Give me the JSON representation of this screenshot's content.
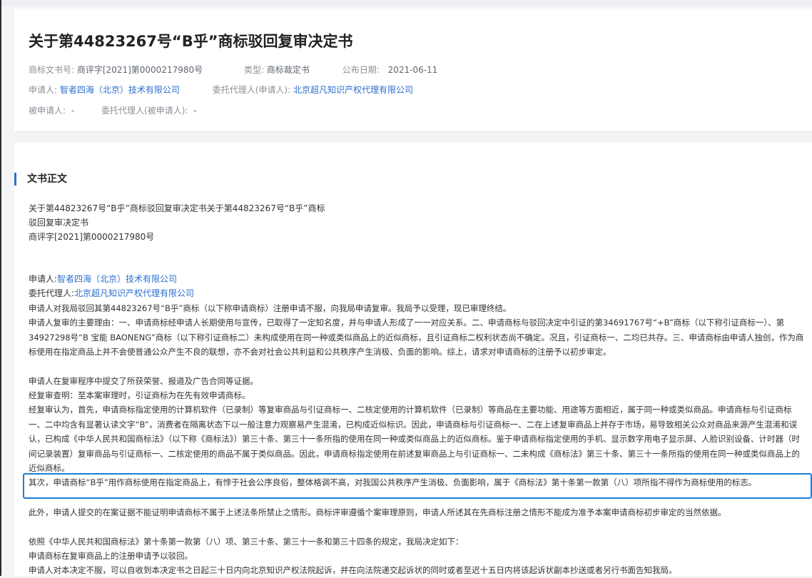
{
  "header": {
    "title": "关于第44823267号“B乎”商标驳回复审决定书",
    "doc_no_label": "商标文书号:",
    "doc_no": "商评字[2021]第0000217980号",
    "type_label": "类型:",
    "type": "商标裁定书",
    "date_label": "公布日期:",
    "date": "2021-06-11",
    "applicant_label": "申请人:",
    "applicant": "智者四海（北京）技术有限公司",
    "agent_label": "委托代理人(申请人):",
    "agent": "北京超凡知识产权代理有限公司",
    "respondent_label": "被申请人:",
    "respondent": "-",
    "resp_agent_label": "委托代理人(被申请人):",
    "resp_agent": "-"
  },
  "body": {
    "section_title": "文书正文",
    "intro": [
      "关于第44823267号“B乎”商标驳回复审决定书关于第44823267号“B乎”商标",
      "驳回复审决定书",
      "商评字[2021]第0000217980号"
    ],
    "applicant_label": "申请人:",
    "applicant": "智者四海（北京）技术有限公司",
    "agent_label": "委托代理人:",
    "agent": "北京超凡知识产权代理有限公司",
    "paragraphs": [
      "申请人对我局驳回其第44823267号“B乎”商标（以下称申请商标）注册申请不服，向我局申请复审。我局予以受理，现已审理终结。",
      "申请人复审的主要理由：一、申请商标经申请人长期使用与宣传，已取得了一定知名度，并与申请人形成了一一对应关系。二、申请商标与驳回决定中引证的第34691767号“+B”商标（以下称引证商标一）、第34927298号“B 宝能 BAONENG”商标（以下称引证商标二）未构成使用在同一种或类似商品上的近似商标，且引证商标二权利状态尚不确定。况且，引证商标一、二均已共存。三、申请商标由申请人独创，作为商标使用在指定商品上并不会使普通公众产生不良的联想，亦不会对社会公共利益和公共秩序产生消极、负面的影响。综上，请求对申请商标的注册予以初步审定。",
      "申请人在复审程序中提交了所获荣誉、报道及广告合同等证据。",
      "经复审查明：至本案审理时，引证商标为在先有效申请商标。",
      "经复审认为，首先，申请商标指定使用的计算机软件（已录制）等复审商品与引证商标一、二核定使用的计算机软件（已录制）等商品在主要功能、用途等方面相近，属于同一种或类似商品。申请商标与引证商标一、二中均含有显著认读文字“B”，消费者在隔离状态下以一般注意力观察易产生混淆，已构成近似标识。因此，申请商标与引证商标一、二在上述复审商品上并存于市场，易导致相关公众对商品来源产生混淆和误认，已构成《中华人民共和国商标法》（以下称《商标法》）第三十条、第三十一条所指的使用在同一种或类似商品上的近似商标。鉴于申请商标指定使用的手机、显示数字用电子显示屏、人脸识别设备、计时器（时间记录装置）复审商品与引证商标一、二核定使用的商品不属于类似商品。因此，申请商标指定使用在前述复审商品上与引证商标一、二未构成《商标法》第三十条、第三十一条所指的使用在同一种或类似商品上的近似商标。",
      "其次，申请商标“B乎”用作商标使用在指定商品上，有悖于社会公序良俗，整体格调不高，对我国公共秩序产生消极、负面影响，属于《商标法》第十条第一款第（八）项所指不得作为商标使用的标志。",
      "此外，申请人提交的在案证据不能证明申请商标不属于上述法条所禁止之情形。商标评审遵循个案审理原则，申请人所述其在先商标注册之情形不能成为准予本案申请商标初步审定的当然依据。",
      "依照《中华人民共和国商标法》第十条第一款第（八）项、第三十条、第三十一条和第三十四条的规定，我局决定如下：",
      "申请商标在复审商品上的注册申请予以驳回。",
      "申请人对本决定不服，可以自收到本决定书之日起三十日内向北京知识产权法院起诉，并在向法院递交起诉状的同时或者至迟十五日内将该起诉状副本抄送或者另行书面告知我局。"
    ]
  }
}
